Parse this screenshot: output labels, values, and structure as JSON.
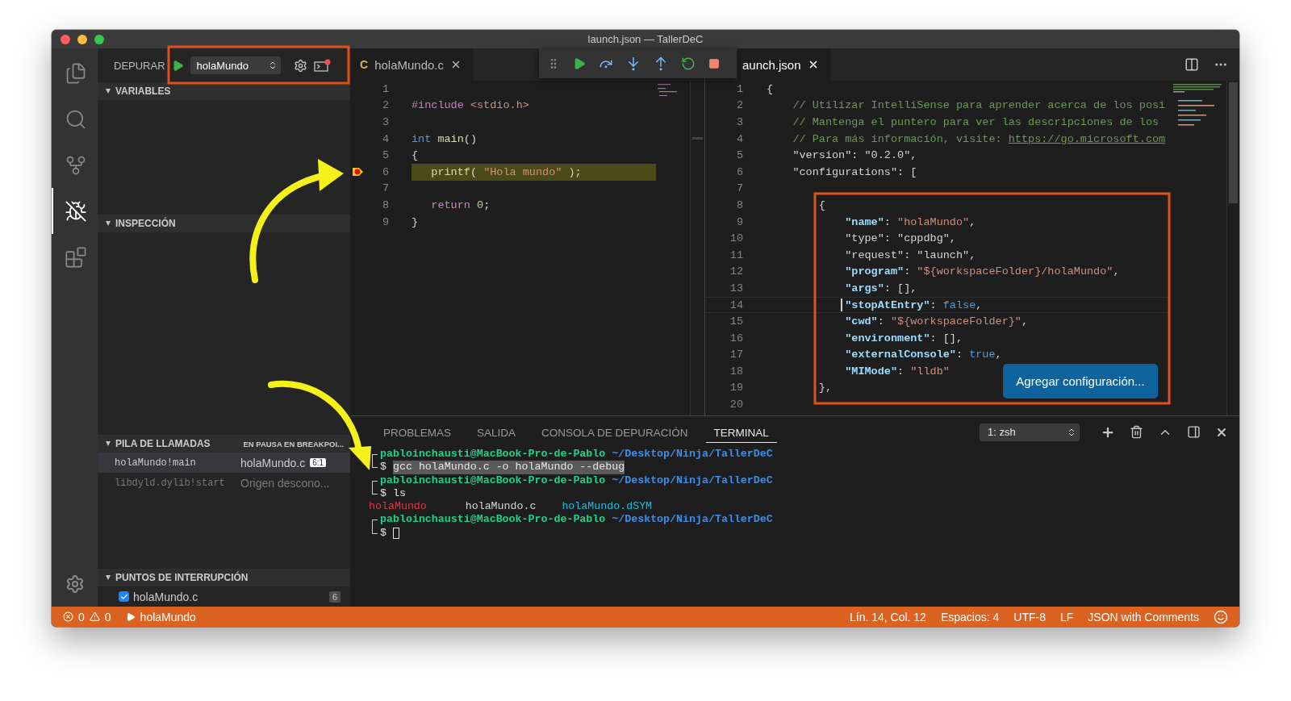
{
  "window": {
    "title": "launch.json — TallerDeC"
  },
  "activity_bar": [
    {
      "kind": "files",
      "selected": false
    },
    {
      "kind": "search",
      "selected": false
    },
    {
      "kind": "source_control",
      "selected": false
    },
    {
      "kind": "debug",
      "selected": true
    },
    {
      "kind": "extensions",
      "selected": false
    }
  ],
  "sidebar": {
    "title": "DEPURAR",
    "configuration": "holaMundo",
    "variables": {
      "title": "VARIABLES",
      "expanded": true
    },
    "watch": {
      "title": "INSPECCIÓN",
      "expanded": true
    },
    "call_stack": {
      "title": "PILA DE LLAMADAS",
      "status": "EN PAUSA EN BREAKPOI...",
      "expanded": true,
      "frames": [
        {
          "function": "holaMundo!main",
          "source": "holaMundo.c",
          "badge": "6:1",
          "selected": true,
          "dimmed": false
        },
        {
          "function": "libdyld.dylib!start",
          "source": "Origen descono...",
          "selected": false,
          "dimmed": true
        }
      ]
    },
    "breakpoints": {
      "title": "PUNTOS DE INTERRUPCIÓN",
      "expanded": true,
      "items": [
        {
          "file": "holaMundo.c",
          "line": "6",
          "checked": true
        }
      ]
    }
  },
  "editors": [
    {
      "tab": {
        "icon_letter": "C",
        "label": "holaMundo.c",
        "selected": false
      },
      "lines": [
        {
          "n": "1",
          "current": false,
          "breakpoint": false
        },
        {
          "n": "2",
          "current": false,
          "breakpoint": false,
          "tokens": [
            {
              "kind": "ctl",
              "text": "#include "
            },
            {
              "kind": "str",
              "text": "<stdio.h>"
            }
          ]
        },
        {
          "n": "3",
          "current": false,
          "breakpoint": false
        },
        {
          "n": "4",
          "current": false,
          "breakpoint": false,
          "tokens": [
            {
              "kind": "kw",
              "text": "int "
            },
            {
              "kind": "fn",
              "text": "main"
            },
            {
              "kind": "plain",
              "text": "()"
            }
          ]
        },
        {
          "n": "5",
          "current": false,
          "breakpoint": false,
          "tokens": [
            {
              "kind": "plain",
              "text": "{"
            }
          ]
        },
        {
          "n": "6",
          "current": true,
          "breakpoint": true,
          "tokens": [
            {
              "kind": "fn",
              "text": "   printf"
            },
            {
              "kind": "plain",
              "text": "( "
            },
            {
              "kind": "str",
              "text": "\"Hola mundo\""
            },
            {
              "kind": "plain",
              "text": " );"
            }
          ]
        },
        {
          "n": "7",
          "current": false,
          "breakpoint": false
        },
        {
          "n": "8",
          "current": false,
          "breakpoint": false,
          "tokens": [
            {
              "kind": "ctl",
              "text": "   return "
            },
            {
              "kind": "num",
              "text": "0"
            },
            {
              "kind": "plain",
              "text": ";"
            }
          ]
        },
        {
          "n": "9",
          "current": false,
          "breakpoint": false,
          "tokens": [
            {
              "kind": "plain",
              "text": "}"
            }
          ]
        }
      ]
    },
    {
      "tab": {
        "label": "aunch.json",
        "selected": true
      },
      "action_button": "Agregar configuración...",
      "lines": [
        {
          "n": "1",
          "cursor": false,
          "tokens": [
            {
              "kind": "plain",
              "text": "{"
            }
          ]
        },
        {
          "n": "2",
          "cursor": false,
          "tokens": [
            {
              "kind": "com",
              "text": "    // Utilizar IntelliSense para aprender acerca de los posi"
            }
          ]
        },
        {
          "n": "3",
          "cursor": false,
          "tokens": [
            {
              "kind": "com",
              "text": "    // Mantenga el puntero para ver las descripciones de los"
            }
          ]
        },
        {
          "n": "4",
          "cursor": false,
          "tokens": [
            {
              "kind": "com",
              "text": "    // Para más información, visite: "
            },
            {
              "kind": "link",
              "text": "https://go.microsoft.com"
            }
          ]
        },
        {
          "n": "5",
          "cursor": false,
          "tokens": [
            {
              "kind": "plain",
              "text": "    \"version\": \"0.2.0\","
            }
          ]
        },
        {
          "n": "6",
          "cursor": false,
          "tokens": [
            {
              "kind": "plain",
              "text": "    \"configurations\": ["
            }
          ]
        },
        {
          "n": "7",
          "cursor": false
        },
        {
          "n": "8",
          "cursor": false,
          "tokens": [
            {
              "kind": "plain",
              "text": "        {"
            }
          ]
        },
        {
          "n": "9",
          "cursor": false,
          "tokens": [
            {
              "kind": "key",
              "text": "            \"name\""
            },
            {
              "kind": "plain",
              "text": ": "
            },
            {
              "kind": "str",
              "text": "\"holaMundo\""
            },
            {
              "kind": "plain",
              "text": ","
            }
          ]
        },
        {
          "n": "10",
          "cursor": false,
          "tokens": [
            {
              "kind": "plain",
              "text": "            \"type\": \"cppdbg\","
            }
          ]
        },
        {
          "n": "11",
          "cursor": false,
          "tokens": [
            {
              "kind": "plain",
              "text": "            \"request\": \"launch\","
            }
          ]
        },
        {
          "n": "12",
          "cursor": false,
          "tokens": [
            {
              "kind": "key",
              "text": "            \"program\""
            },
            {
              "kind": "plain",
              "text": ": "
            },
            {
              "kind": "str",
              "text": "\"${workspaceFolder}/holaMundo\""
            },
            {
              "kind": "plain",
              "text": ","
            }
          ]
        },
        {
          "n": "13",
          "cursor": false,
          "tokens": [
            {
              "kind": "key",
              "text": "            \"args\""
            },
            {
              "kind": "plain",
              "text": ": [],"
            }
          ]
        },
        {
          "n": "14",
          "cursor": true,
          "tokens": [
            {
              "kind": "key",
              "text": "            \"stopAtEntry\""
            },
            {
              "kind": "plain",
              "text": ": "
            },
            {
              "kind": "const",
              "text": "false"
            },
            {
              "kind": "plain",
              "text": ","
            }
          ]
        },
        {
          "n": "15",
          "cursor": false,
          "tokens": [
            {
              "kind": "key",
              "text": "            \"cwd\""
            },
            {
              "kind": "plain",
              "text": ": "
            },
            {
              "kind": "str",
              "text": "\"${workspaceFolder}\""
            },
            {
              "kind": "plain",
              "text": ","
            }
          ]
        },
        {
          "n": "16",
          "cursor": false,
          "tokens": [
            {
              "kind": "key",
              "text": "            \"environment\""
            },
            {
              "kind": "plain",
              "text": ": [],"
            }
          ]
        },
        {
          "n": "17",
          "cursor": false,
          "tokens": [
            {
              "kind": "key",
              "text": "            \"externalConsole\""
            },
            {
              "kind": "plain",
              "text": ": "
            },
            {
              "kind": "const",
              "text": "true"
            },
            {
              "kind": "plain",
              "text": ","
            }
          ]
        },
        {
          "n": "18",
          "cursor": false,
          "tokens": [
            {
              "kind": "key",
              "text": "            \"MIMode\""
            },
            {
              "kind": "plain",
              "text": ": "
            },
            {
              "kind": "str",
              "text": "\"lldb\""
            }
          ]
        },
        {
          "n": "19",
          "cursor": false,
          "tokens": [
            {
              "kind": "plain",
              "text": "        },"
            }
          ]
        },
        {
          "n": "20",
          "cursor": false
        }
      ]
    }
  ],
  "panel": {
    "tabs": [
      {
        "label": "PROBLEMAS",
        "selected": false
      },
      {
        "label": "SALIDA",
        "selected": false
      },
      {
        "label": "CONSOLA DE DEPURACIÓN",
        "selected": false
      },
      {
        "label": "TERMINAL",
        "selected": true
      }
    ],
    "terminal_select": "1: zsh",
    "terminal": [
      {
        "user": "pabloinchausti@MacBook-Pro-de-Pablo",
        "path": "~/Desktop/Ninja/TallerDeC",
        "symbol": "$",
        "command": "gcc holaMundo.c -o holaMundo --debug",
        "highlighted": true,
        "cursor": false
      },
      {
        "user": "pabloinchausti@MacBook-Pro-de-Pablo",
        "path": "~/Desktop/Ninja/TallerDeC",
        "symbol": "$",
        "command": "ls",
        "highlighted": false,
        "cursor": false,
        "output": [
          {
            "text": "holaMundo",
            "color": "#e0383e"
          },
          {
            "text": "holaMundo.c",
            "color": "#d4d4d4"
          },
          {
            "text": "holaMundo.dSYM",
            "color": "#29b8db"
          }
        ]
      },
      {
        "user": "pabloinchausti@MacBook-Pro-de-Pablo",
        "path": "~/Desktop/Ninja/TallerDeC",
        "symbol": "$",
        "cursor": true
      }
    ]
  },
  "status_bar": {
    "errors": "0",
    "warnings": "0",
    "launch": "holaMundo",
    "items": [
      "Lín. 14, Col. 12",
      "Espacios: 4",
      "UTF-8",
      "LF",
      "JSON with Comments"
    ]
  }
}
